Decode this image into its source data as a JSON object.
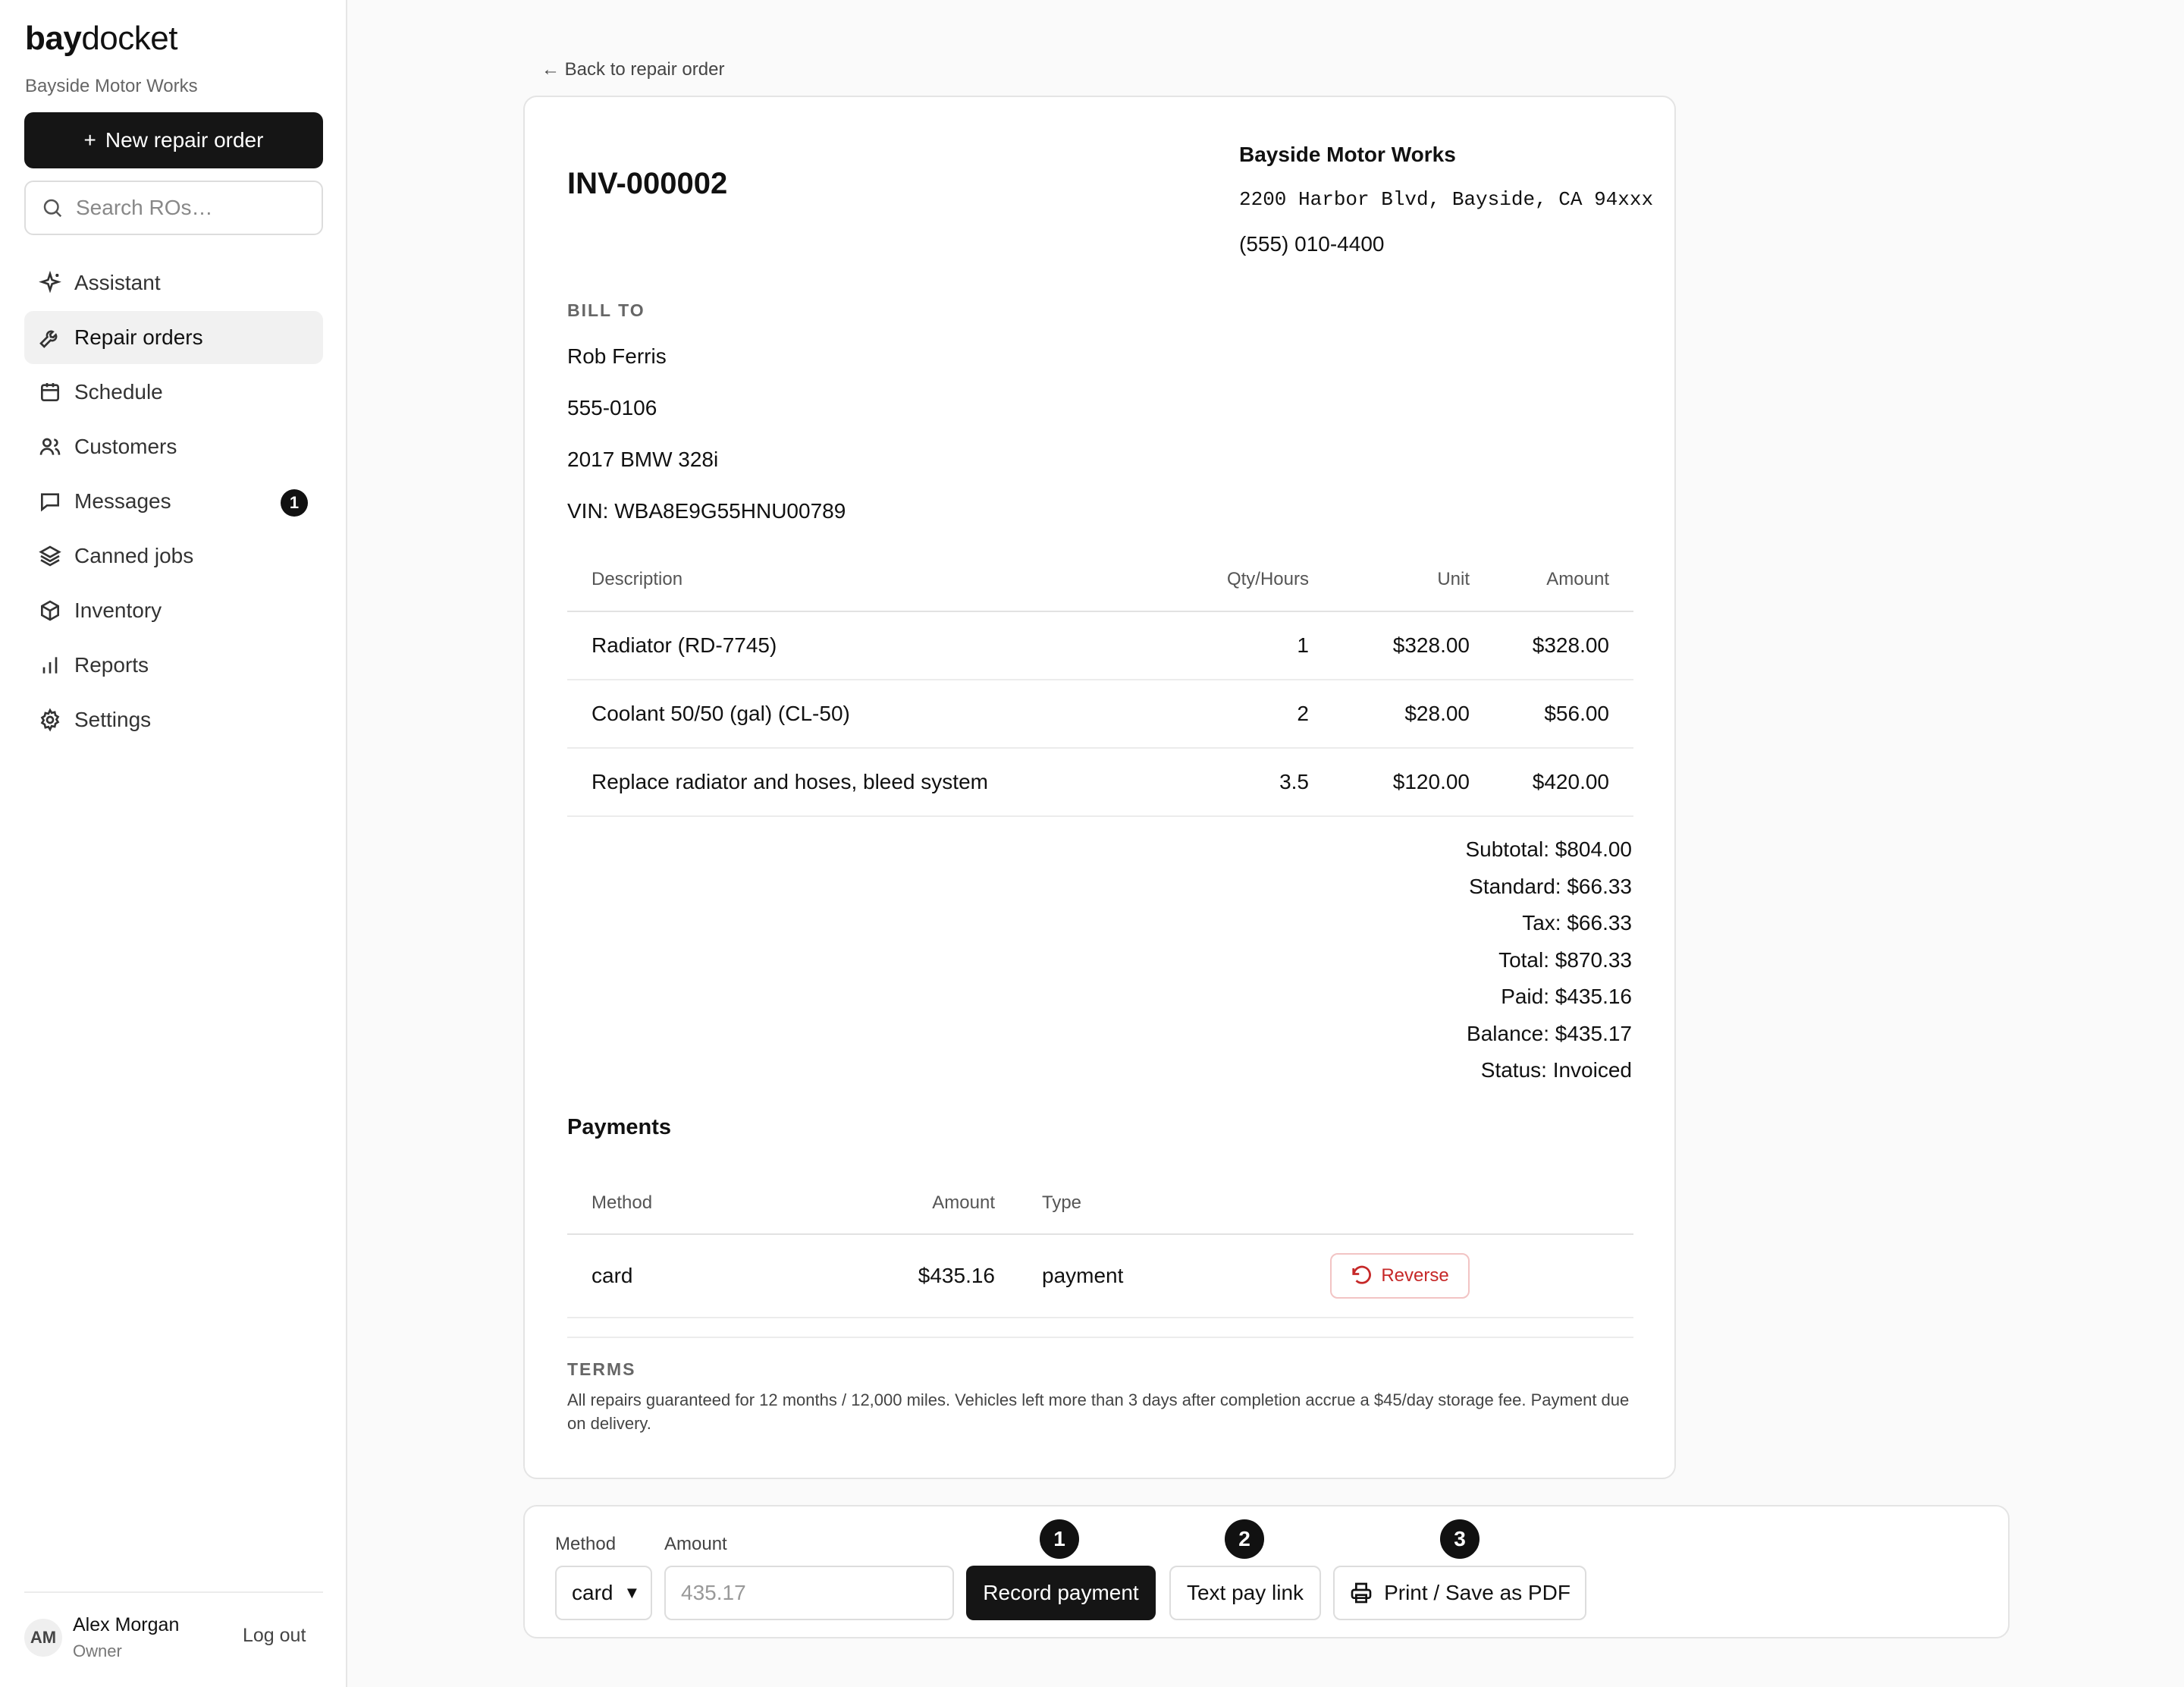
{
  "app": {
    "logo_bold": "bay",
    "logo_rest": "docket",
    "shop_name": "Bayside Motor Works"
  },
  "sidebar": {
    "new_ro_label": "New repair order",
    "search_placeholder": "Search ROs…",
    "items": [
      {
        "label": "Assistant",
        "icon": "sparkle-icon"
      },
      {
        "label": "Repair orders",
        "icon": "wrench-icon",
        "active": true
      },
      {
        "label": "Schedule",
        "icon": "calendar-icon"
      },
      {
        "label": "Customers",
        "icon": "users-icon"
      },
      {
        "label": "Messages",
        "icon": "message-icon",
        "badge": "1"
      },
      {
        "label": "Canned jobs",
        "icon": "layers-icon"
      },
      {
        "label": "Inventory",
        "icon": "box-icon"
      },
      {
        "label": "Reports",
        "icon": "bar-chart-icon"
      },
      {
        "label": "Settings",
        "icon": "gear-icon"
      }
    ],
    "user": {
      "initials": "AM",
      "name": "Alex Morgan",
      "role": "Owner",
      "logout_label": "Log out"
    }
  },
  "main": {
    "back_label": "← Back to repair order",
    "invoice": {
      "number": "INV-000002",
      "business": {
        "name": "Bayside Motor Works",
        "address": "2200 Harbor Blvd, Bayside, CA 94xxx",
        "phone": "(555) 010-4400"
      },
      "bill_to_label": "BILL TO",
      "bill_to": {
        "name": "Rob Ferris",
        "phone": "555-0106",
        "vehicle": "2017 BMW 328i",
        "vin": "VIN: WBA8E9G55HNU00789"
      },
      "columns": {
        "description": "Description",
        "qty": "Qty/Hours",
        "unit": "Unit",
        "amount": "Amount"
      },
      "lines": [
        {
          "description": "Radiator (RD-7745)",
          "qty": "1",
          "unit": "$328.00",
          "amount": "$328.00"
        },
        {
          "description": "Coolant 50/50 (gal) (CL-50)",
          "qty": "2",
          "unit": "$28.00",
          "amount": "$56.00"
        },
        {
          "description": "Replace radiator and hoses, bleed system",
          "qty": "3.5",
          "unit": "$120.00",
          "amount": "$420.00"
        }
      ],
      "totals": {
        "subtotal": "Subtotal: $804.00",
        "standard": "Standard: $66.33",
        "tax": "Tax: $66.33",
        "total": "Total: $870.33",
        "paid": "Paid: $435.16",
        "balance": "Balance: $435.17",
        "status": "Status: Invoiced"
      },
      "payments": {
        "title": "Payments",
        "columns": {
          "method": "Method",
          "amount": "Amount",
          "type": "Type"
        },
        "rows": [
          {
            "method": "card",
            "amount": "$435.16",
            "type": "payment",
            "action": "Reverse"
          }
        ]
      },
      "terms_label": "TERMS",
      "terms_text": "All repairs guaranteed for 12 months / 12,000 miles. Vehicles left more than 3 days after completion accrue a $45/day storage fee. Payment due on delivery."
    },
    "actions": {
      "method_label": "Method",
      "method_value": "card",
      "amount_label": "Amount",
      "amount_placeholder": "435.17",
      "record_label": "Record payment",
      "text_link_label": "Text pay link",
      "print_label": "Print / Save as PDF",
      "steps": [
        "1",
        "2",
        "3"
      ]
    }
  },
  "colors": {
    "primary": "#151515",
    "danger": "#c62828",
    "badge": "#111111"
  }
}
